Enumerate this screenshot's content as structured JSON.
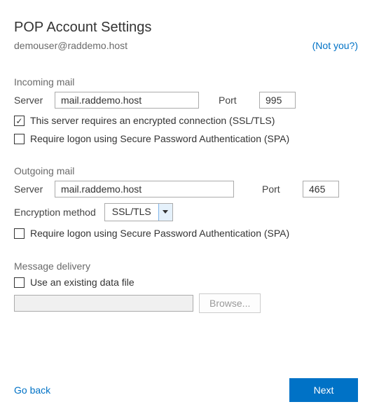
{
  "header": {
    "title": "POP Account Settings",
    "email": "demouser@raddemo.host",
    "not_you": "(Not you?)"
  },
  "incoming": {
    "section": "Incoming mail",
    "server_label": "Server",
    "server_value": "mail.raddemo.host",
    "port_label": "Port",
    "port_value": "995",
    "ssl_checked": "true",
    "ssl_label": "This server requires an encrypted connection (SSL/TLS)",
    "spa_checked": "false",
    "spa_label": "Require logon using Secure Password Authentication (SPA)"
  },
  "outgoing": {
    "section": "Outgoing mail",
    "server_label": "Server",
    "server_value": "mail.raddemo.host",
    "port_label": "Port",
    "port_value": "465",
    "enc_label": "Encryption method",
    "enc_value": "SSL/TLS",
    "spa_checked": "false",
    "spa_label": "Require logon using Secure Password Authentication (SPA)"
  },
  "delivery": {
    "section": "Message delivery",
    "existing_checked": "false",
    "existing_label": "Use an existing data file",
    "file_value": "",
    "browse": "Browse..."
  },
  "footer": {
    "go_back": "Go back",
    "next": "Next"
  }
}
